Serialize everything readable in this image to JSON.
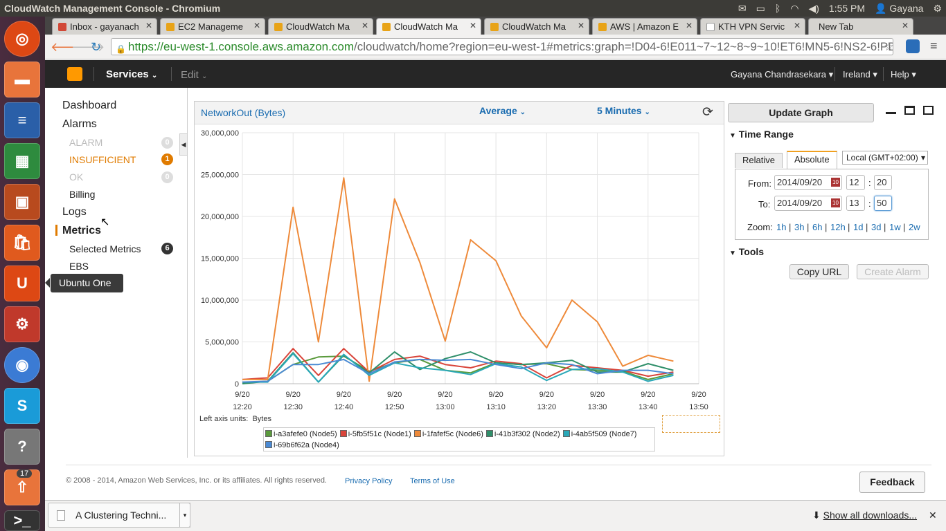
{
  "os": {
    "window_title": "CloudWatch Management Console - Chromium",
    "clock": "1:55 PM",
    "user": "Gayana",
    "launcher_badge": "17",
    "tooltip": "Ubuntu One",
    "tray_icons": [
      "mail-icon",
      "battery-icon",
      "bluetooth-icon",
      "wifi-icon",
      "volume-icon",
      "user-icon",
      "gear-icon"
    ]
  },
  "browser": {
    "tabs": [
      {
        "label": "Inbox - gayanach",
        "color": "#d14836"
      },
      {
        "label": "EC2 Manageme",
        "color": "#e8a317"
      },
      {
        "label": "CloudWatch Ma",
        "color": "#e8a317"
      },
      {
        "label": "CloudWatch Ma",
        "color": "#e8a317"
      },
      {
        "label": "CloudWatch Ma",
        "color": "#e8a317"
      },
      {
        "label": "AWS | Amazon E",
        "color": "#e8a317"
      },
      {
        "label": "KTH VPN Servic",
        "color": "#999999"
      },
      {
        "label": "New Tab",
        "color": ""
      }
    ],
    "url": "https://eu-west-1.console.aws.amazon.com/cloudwatch/home?region=eu-west-1#metrics:graph=!D04-6!E011~7~12~8~9~10!ET6!MN5-6!NS2-6!PD1-6!SS:",
    "url_host": "https://eu-west-1.console.aws.amazon.com",
    "url_rest": "/cloudwatch/home?region=eu-west-1#metrics:graph=!D04-6!E011~7~12~8~9~10!ET6!MN5-6!NS2-6!PD1-6!SS:"
  },
  "aws_header": {
    "services": "Services",
    "edit": "Edit",
    "user": "Gayana Chandrasekara",
    "region": "Ireland",
    "help": "Help"
  },
  "leftnav": {
    "dashboard": "Dashboard",
    "alarms": "Alarms",
    "alarm": "ALARM",
    "alarm_count": "0",
    "insufficient": "INSUFFICIENT",
    "insufficient_count": "1",
    "ok": "OK",
    "ok_count": "0",
    "billing": "Billing",
    "logs": "Logs",
    "metrics": "Metrics",
    "selected_metrics": "Selected Metrics",
    "selected_count": "6",
    "ebs": "EBS"
  },
  "graph": {
    "title": "NetworkOut (Bytes)",
    "statistic": "Average",
    "period": "5 Minutes",
    "units_label": "Left axis units:",
    "units": "Bytes"
  },
  "chart_data": {
    "type": "line",
    "ylim": [
      0,
      30000000
    ],
    "yticks": [
      "30,000,000",
      "25,000,000",
      "20,000,000",
      "15,000,000",
      "10,000,000",
      "5,000,000",
      "0"
    ],
    "xticks": [
      [
        "9/20",
        "12:20"
      ],
      [
        "9/20",
        "12:30"
      ],
      [
        "9/20",
        "12:40"
      ],
      [
        "9/20",
        "12:50"
      ],
      [
        "9/20",
        "13:00"
      ],
      [
        "9/20",
        "13:10"
      ],
      [
        "9/20",
        "13:20"
      ],
      [
        "9/20",
        "13:30"
      ],
      [
        "9/20",
        "13:40"
      ],
      [
        "9/20",
        "13:50"
      ]
    ],
    "x": [
      "12:20",
      "12:25",
      "12:30",
      "12:35",
      "12:40",
      "12:45",
      "12:50",
      "12:55",
      "13:00",
      "13:05",
      "13:10",
      "13:15",
      "13:20",
      "13:25",
      "13:30",
      "13:35",
      "13:40",
      "13:45"
    ],
    "series": [
      {
        "name": "i-a3afefe0 (Node5)",
        "color": "#5a9a3c",
        "values": [
          100000,
          300000,
          2300000,
          3200000,
          3300000,
          1500000,
          2500000,
          2900000,
          1600000,
          1300000,
          2500000,
          2300000,
          2400000,
          1700000,
          1600000,
          1500000,
          500000,
          1200000
        ]
      },
      {
        "name": "i-5fb5f51c (Node1)",
        "color": "#d9443a",
        "values": [
          500000,
          700000,
          4200000,
          1000000,
          4200000,
          1400000,
          2900000,
          3300000,
          2300000,
          1900000,
          2700000,
          2400000,
          700000,
          2200000,
          1900000,
          1600000,
          900000,
          1400000
        ]
      },
      {
        "name": "i-1fafef5c (Node6)",
        "color": "#ee8a3a",
        "values": [
          500000,
          500000,
          21100000,
          5000000,
          24600000,
          300000,
          22100000,
          14500000,
          5100000,
          17200000,
          14700000,
          8100000,
          4300000,
          10000000,
          7400000,
          2100000,
          3400000,
          2700000
        ]
      },
      {
        "name": "i-41b3f302 (Node2)",
        "color": "#2f8f6a",
        "values": [
          0,
          300000,
          3700000,
          200000,
          3400000,
          1300000,
          3800000,
          1700000,
          3000000,
          3800000,
          2500000,
          2300000,
          2500000,
          2800000,
          1400000,
          1400000,
          2400000,
          1600000
        ]
      },
      {
        "name": "i-4ab5f509 (Node7)",
        "color": "#2aa8b8",
        "values": [
          200000,
          200000,
          3600000,
          200000,
          3500000,
          1000000,
          2500000,
          1900000,
          1600000,
          1100000,
          2400000,
          2000000,
          400000,
          1700000,
          1800000,
          1400000,
          300000,
          1000000
        ]
      },
      {
        "name": "i-69b6f62a (Node4)",
        "color": "#4a8ad4",
        "values": [
          200000,
          300000,
          2300000,
          2300000,
          2900000,
          1200000,
          2600000,
          2900000,
          2800000,
          2900000,
          2300000,
          1800000,
          2500000,
          2300000,
          1200000,
          1600000,
          1600000,
          1200000
        ]
      }
    ]
  },
  "right": {
    "update": "Update Graph",
    "time_range": "Time Range",
    "relative": "Relative",
    "absolute": "Absolute",
    "timezone": "Local (GMT+02:00)",
    "from_label": "From:",
    "from_date": "2014/09/20",
    "from_h": "12",
    "from_m": "20",
    "to_label": "To:",
    "to_date": "2014/09/20",
    "to_h": "13",
    "to_m": "50",
    "colon": ":",
    "zoom_label": "Zoom:",
    "zoom": [
      "1h",
      "3h",
      "6h",
      "12h",
      "1d",
      "3d",
      "1w",
      "2w"
    ],
    "tools": "Tools",
    "copy_url": "Copy URL",
    "create_alarm": "Create Alarm"
  },
  "footer": {
    "copyright": "© 2008 - 2014, Amazon Web Services, Inc. or its affiliates. All rights reserved.",
    "privacy": "Privacy Policy",
    "terms": "Terms of Use",
    "feedback": "Feedback"
  },
  "downloads": {
    "item": "A Clustering Techni...",
    "show_all": "Show all downloads..."
  }
}
